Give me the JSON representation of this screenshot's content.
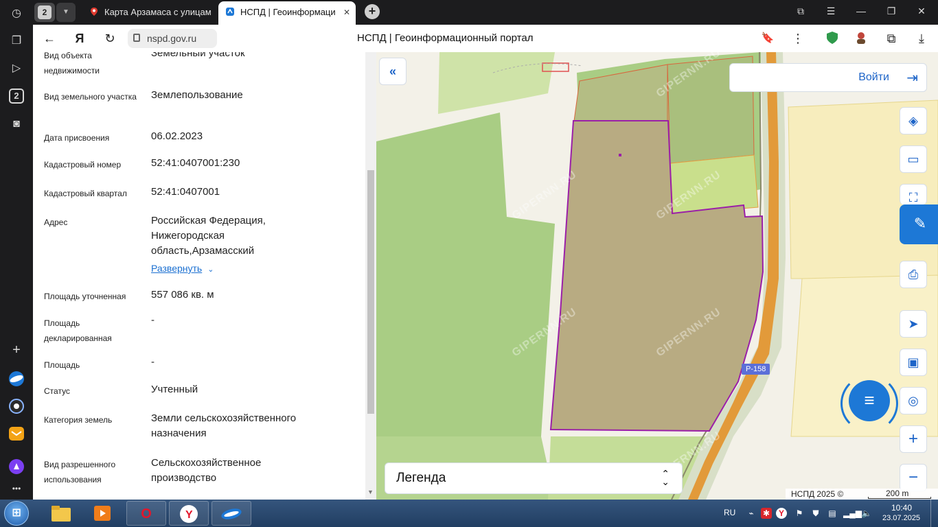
{
  "browser": {
    "tab_count": "2",
    "tabs": [
      {
        "title": "Карта Арзамаса с улицам",
        "active": false
      },
      {
        "title": "НСПД | Геоинформаци",
        "active": true
      }
    ],
    "url": "nspd.gov.ru",
    "page_title": "НСПД | Геоинформационный портал",
    "sidepanel_badge": "2"
  },
  "info": {
    "rows": [
      {
        "label": "Вид объекта недвижимости",
        "value": "Земельный участок"
      },
      {
        "label": "Вид земельного участка",
        "value": "Землепользование"
      },
      {
        "label": "Дата присвоения",
        "value": "06.02.2023"
      },
      {
        "label": "Кадастровый номер",
        "value": "52:41:0407001:230"
      },
      {
        "label": "Кадастровый квартал",
        "value": "52:41:0407001"
      },
      {
        "label": "Адрес",
        "value": "Российская Федерация, Нижегородская область,Арзамасский"
      },
      {
        "label": "Площадь уточненная",
        "value": "557 086 кв. м"
      },
      {
        "label": "Площадь декларированная",
        "value": "-"
      },
      {
        "label": "Площадь",
        "value": "-"
      },
      {
        "label": "Статус",
        "value": "Учтенный"
      },
      {
        "label": "Категория земель",
        "value": "Земли сельскохозяйственного назначения"
      },
      {
        "label": "Вид разрешенного использования",
        "value": "Сельскохозяйственное производство"
      }
    ],
    "expand_label": "Развернуть"
  },
  "map": {
    "login_label": "Войти",
    "legend_label": "Легенда",
    "copyright": "НСПД 2025 ©",
    "scale": "200 m",
    "road_label": "Р-158",
    "watermark": "GIPERNN.RU",
    "colors": {
      "accent": "#1d64c8",
      "parcel_outline": "#9b1fa8",
      "parcel_fill": "#b8ab82",
      "field_green": "#a9cd84",
      "road_orange": "#e29a3a"
    }
  },
  "taskbar": {
    "lang": "RU",
    "time": "10:40",
    "date": "23.07.2025"
  }
}
